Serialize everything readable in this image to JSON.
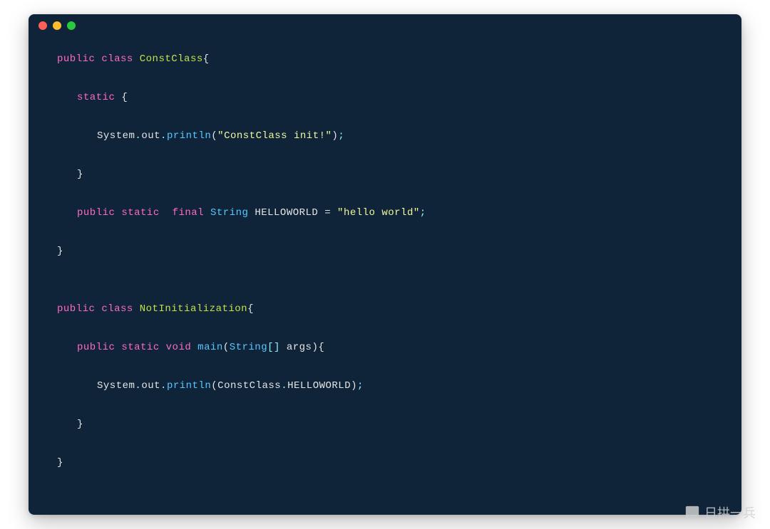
{
  "window": {
    "traffic_lights": [
      "red",
      "yellow",
      "green"
    ]
  },
  "code": {
    "l1": {
      "kw_public": "public",
      "kw_class": "class",
      "cls": "ConstClass",
      "brace": "{"
    },
    "l2": {
      "kw_static": "static",
      "brace": " {"
    },
    "l3": {
      "sys": "System",
      "dot1": ".",
      "out": "out",
      "dot2": ".",
      "println": "println",
      "lp": "(",
      "str": "\"ConstClass init!\"",
      "rp": ")",
      "semi": ";"
    },
    "l4": {
      "brace": "}"
    },
    "l5": {
      "kw_public": "public",
      "kw_static": "static",
      "kw_final": "final",
      "type": "String",
      "name": "HELLOWORLD",
      "eq": " = ",
      "str": "\"hello world\"",
      "semi": ";"
    },
    "l6": {
      "brace": "}"
    },
    "l7": "",
    "l8": {
      "kw_public": "public",
      "kw_class": "class",
      "cls": "NotInitialization",
      "brace": "{"
    },
    "l9": {
      "kw_public": "public",
      "kw_static": "static",
      "kw_void": "void",
      "main": "main",
      "lp": "(",
      "type": "String",
      "brk": "[]",
      "args": " args",
      "rp": ")",
      "brace": "{"
    },
    "l10": {
      "sys": "System",
      "dot1": ".",
      "out": "out",
      "dot2": ".",
      "println": "println",
      "lp": "(",
      "cls": "ConstClass",
      "dot3": ".",
      "field": "HELLOWORLD",
      "rp": ")",
      "semi": ";"
    },
    "l11": {
      "brace": "}"
    },
    "l12": {
      "brace": "}"
    }
  },
  "watermark": {
    "text": "日拱一兵"
  }
}
